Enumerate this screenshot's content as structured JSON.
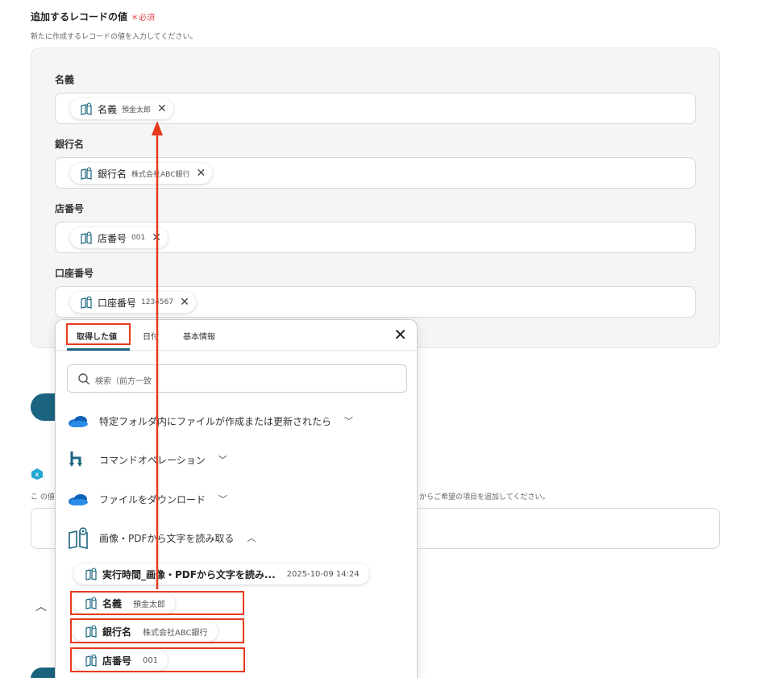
{
  "section": {
    "title": "追加するレコードの値",
    "required": "＊必須",
    "description": "新たに作成するレコードの値を入力してください。"
  },
  "fields": [
    {
      "label": "名義",
      "chip_name": "名義",
      "chip_value": "預金太郎"
    },
    {
      "label": "銀行名",
      "chip_name": "銀行名",
      "chip_value": "株式会社ABC銀行"
    },
    {
      "label": "店番号",
      "chip_name": "店番号",
      "chip_value": "001"
    },
    {
      "label": "口座番号",
      "chip_name": "口座番号",
      "chip_value": "1234567"
    }
  ],
  "background": {
    "partial_text": "こ の値",
    "partial_text_right": "からご希望の項目を追加してください。"
  },
  "popup": {
    "tabs": [
      "取得した値",
      "日付",
      "基本情報"
    ],
    "search_placeholder": "検索（前方一致",
    "sections": [
      {
        "label": "特定フォルダ内にファイルが作成または更新されたら",
        "icon": "onedrive-cloud-icon"
      },
      {
        "label": "コマンドオペレーション",
        "icon": "command-branch-icon"
      },
      {
        "label": "ファイルをダウンロード",
        "icon": "onedrive-cloud-icon"
      },
      {
        "label": "画像・PDFから文字を読み取る",
        "icon": "ocr-book-icon"
      }
    ],
    "items": [
      {
        "name": "実行時間_画像・PDFから文字を読み...",
        "value": "2025-10-09 14:24"
      },
      {
        "name": "名義",
        "value": "預金太郎"
      },
      {
        "name": "銀行名",
        "value": "株式会社ABC銀行"
      },
      {
        "name": "店番号",
        "value": "001"
      }
    ]
  },
  "colors": {
    "accent": "#1b6480",
    "highlight": "#e8391e",
    "required": "#e0464b"
  }
}
